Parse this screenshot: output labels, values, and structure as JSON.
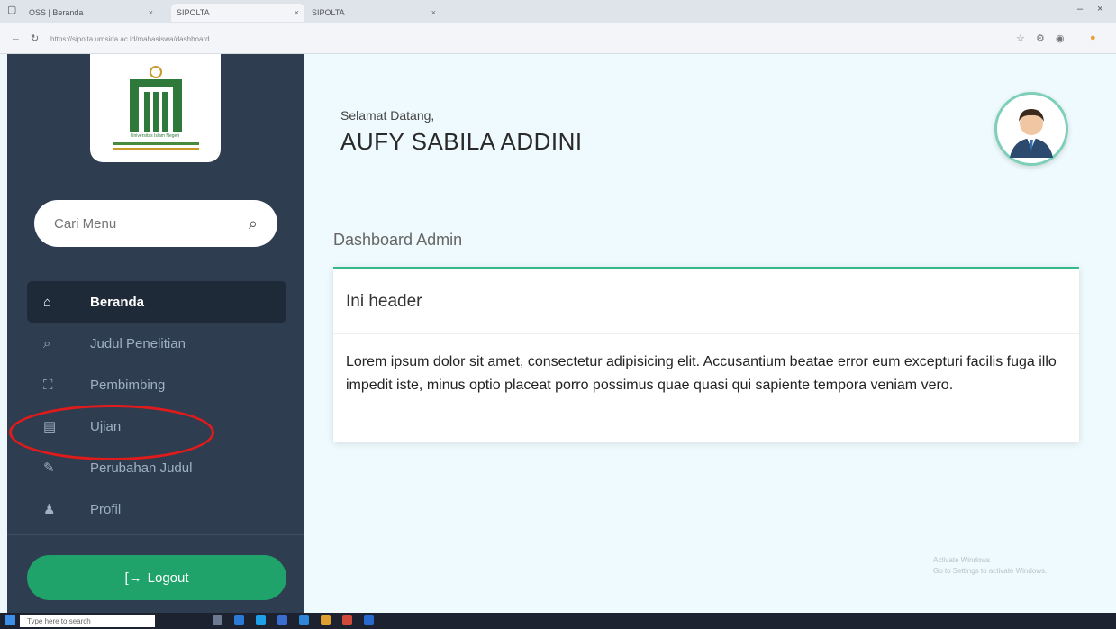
{
  "browser": {
    "tabs": [
      {
        "title": "OSS | Beranda"
      },
      {
        "title": "SIPOLTA"
      },
      {
        "title": "SIPOLTA"
      }
    ],
    "url": "https://sipolta.umsida.ac.id/mahasiswa/dashboard"
  },
  "sidebar": {
    "logo_caption": "Universitas Islam Negeri",
    "search": {
      "placeholder": "Cari Menu",
      "icon": "search-icon"
    },
    "items": [
      {
        "label": "Beranda",
        "icon": "home-icon",
        "glyph": "⌂",
        "active": true
      },
      {
        "label": "Judul Penelitian",
        "icon": "search-icon",
        "glyph": "⌕",
        "active": false
      },
      {
        "label": "Pembimbing",
        "icon": "scan-icon",
        "glyph": "⛶",
        "active": false
      },
      {
        "label": "Ujian",
        "icon": "book-icon",
        "glyph": "▤",
        "active": false
      },
      {
        "label": "Perubahan Judul",
        "icon": "file-edit-icon",
        "glyph": "✎",
        "active": false
      },
      {
        "label": "Profil",
        "icon": "user-icon",
        "glyph": "♟",
        "active": false
      }
    ],
    "logout": {
      "label": "Logout",
      "glyph": "[→"
    }
  },
  "main": {
    "greeting": "Selamat Datang,",
    "username": "AUFY SABILA ADDINI",
    "dashboard_title": "Dashboard Admin",
    "card": {
      "header": "Ini header",
      "body": "Lorem ipsum dolor sit amet, consectetur adipisicing elit. Accusantium beatae error eum excepturi facilis fuga illo impedit iste, minus optio placeat porro possimus quae quasi qui sapiente tempora veniam vero."
    },
    "watermark": {
      "line1": "Activate Windows",
      "line2": "Go to Settings to activate Windows."
    }
  },
  "taskbar": {
    "search_placeholder": "Type here to search"
  },
  "colors": {
    "sidebar_bg": "#2e3d50",
    "active_item_bg": "#1f2a38",
    "accent_green": "#1fa36a",
    "main_bg": "#eefafd",
    "annotation_red": "#e01b1b"
  }
}
